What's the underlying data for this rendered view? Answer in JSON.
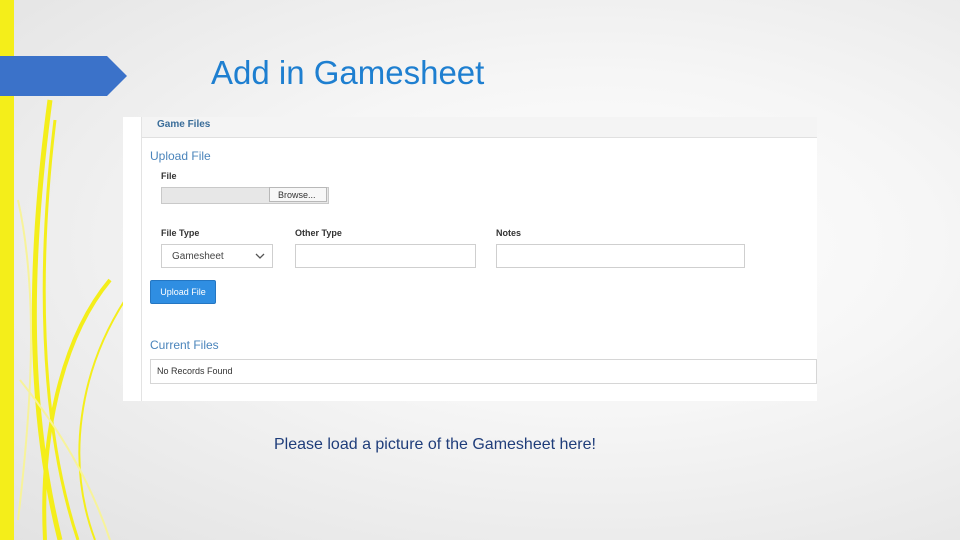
{
  "slide": {
    "title": "Add in Gamesheet",
    "caption": "Please load a picture of the Gamesheet here!",
    "accent_color": "#1e7fd0",
    "decor_color": "#f4ee1a",
    "arrow_color": "#3b72c9"
  },
  "panel": {
    "header": "Game Files",
    "upload_section_title": "Upload File",
    "file_label": "File",
    "browse_label": "Browse...",
    "file_type_label": "File Type",
    "file_type_value": "Gamesheet",
    "other_type_label": "Other Type",
    "other_type_value": "",
    "notes_label": "Notes",
    "notes_value": "",
    "upload_button_label": "Upload File",
    "current_files_title": "Current Files",
    "no_records_text": "No Records Found",
    "button_color": "#2f8ee2",
    "icons": {
      "select_chevron": "chevron-down-icon"
    }
  }
}
